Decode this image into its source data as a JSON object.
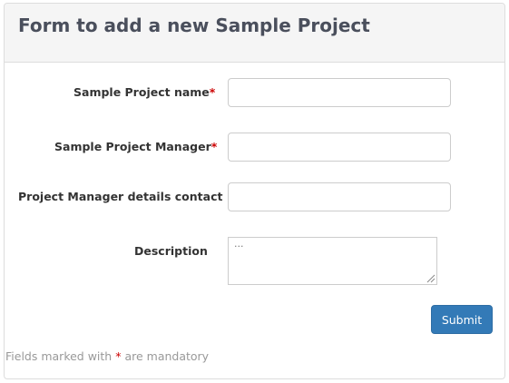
{
  "form": {
    "title": "Form to add a new Sample Project",
    "required_marker": "*",
    "fields": [
      {
        "label": "Sample Project name",
        "required": true,
        "value": ""
      },
      {
        "label": "Sample Project Manager",
        "required": true,
        "value": ""
      },
      {
        "label": "Project Manager details contact",
        "required": false,
        "value": ""
      },
      {
        "label": "Description",
        "required": false,
        "value": "",
        "placeholder": "..."
      }
    ],
    "submit_label": "Submit",
    "footnote": {
      "prefix": "Fields marked with",
      "marker": "*",
      "suffix": "are mandatory"
    }
  },
  "colors": {
    "header_bg": "#f5f5f5",
    "title_text": "#4a4f5c",
    "required_marker": "#cc0000",
    "primary_button": "#337ab7",
    "muted_text": "#999999"
  },
  "icons": {
    "textarea_resize": "resize-grip-icon"
  }
}
